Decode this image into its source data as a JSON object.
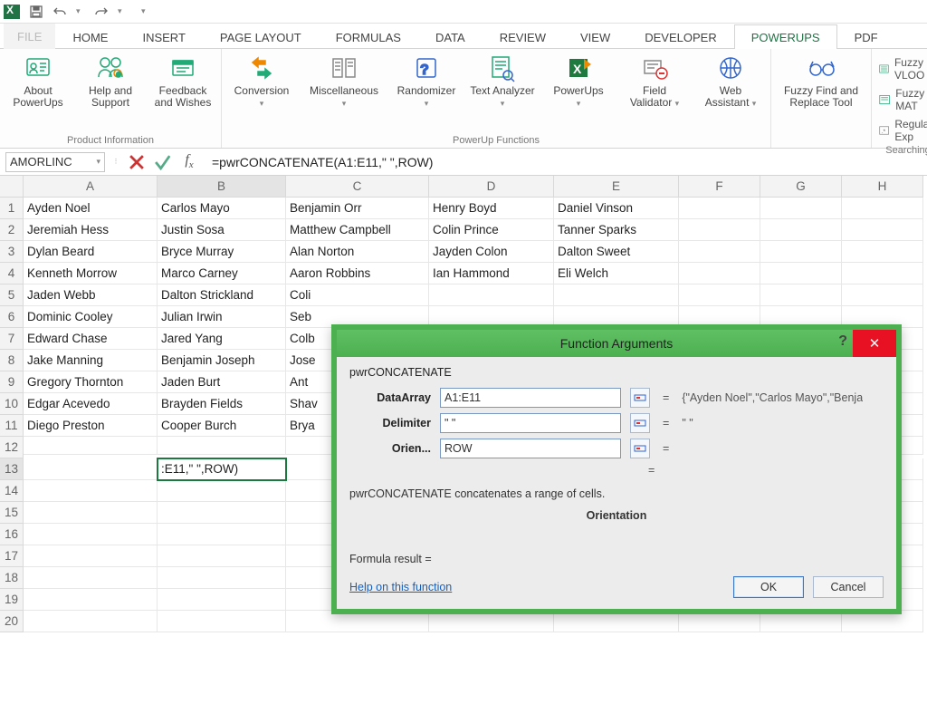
{
  "qat": {
    "save": "Save",
    "undo": "Undo",
    "redo": "Redo"
  },
  "tabs": {
    "file": "FILE",
    "home": "HOME",
    "insert": "INSERT",
    "page_layout": "PAGE LAYOUT",
    "formulas": "FORMULAS",
    "data": "DATA",
    "review": "REVIEW",
    "view": "VIEW",
    "developer": "DEVELOPER",
    "powerups": "POWERUPS",
    "pdf": "PDF"
  },
  "ribbon": {
    "group1": {
      "about": "About PowerUps",
      "help": "Help and Support",
      "feedback": "Feedback and Wishes",
      "label": "Product Information"
    },
    "group2": {
      "conversion": "Conversion",
      "misc": "Miscellaneous",
      "randomizer": "Randomizer",
      "text": "Text Analyzer",
      "powerups": "PowerUps",
      "field": "Field Validator",
      "web": "Web Assistant",
      "label": "PowerUp Functions"
    },
    "group3": {
      "fuzzy": "Fuzzy Find and Replace Tool"
    },
    "group4": {
      "vlook": "Fuzzy VLOO",
      "match": "Fuzzy MAT",
      "regex": "Regular Exp",
      "label": "Searching"
    }
  },
  "fml": {
    "name": "AMORLINC",
    "formula": "=pwrCONCATENATE(A1:E11,\" \",ROW)"
  },
  "columns": [
    "A",
    "B",
    "C",
    "D",
    "E",
    "F",
    "G",
    "H"
  ],
  "rows_visible": [
    "1",
    "2",
    "3",
    "4",
    "5",
    "6",
    "7",
    "8",
    "9",
    "10",
    "11",
    "12",
    "13",
    "14",
    "15",
    "16",
    "17",
    "18",
    "19",
    "20"
  ],
  "active_cell_display": ":E11,\" \",ROW)",
  "data": [
    [
      "Ayden Noel",
      "Carlos Mayo",
      "Benjamin Orr",
      "Henry Boyd",
      "Daniel Vinson"
    ],
    [
      "Jeremiah Hess",
      "Justin Sosa",
      "Matthew Campbell",
      "Colin Prince",
      "Tanner Sparks"
    ],
    [
      "Dylan Beard",
      "Bryce Murray",
      "Alan Norton",
      "Jayden Colon",
      "Dalton Sweet"
    ],
    [
      "Kenneth Morrow",
      "Marco Carney",
      "Aaron Robbins",
      "Ian Hammond",
      "Eli Welch"
    ],
    [
      "Jaden Webb",
      "Dalton Strickland",
      "Coli",
      "",
      " "
    ],
    [
      "Dominic Cooley",
      "Julian Irwin",
      "Seb",
      "",
      " "
    ],
    [
      "Edward Chase",
      "Jared Yang",
      "Colb",
      "",
      " "
    ],
    [
      "Jake Manning",
      "Benjamin Joseph",
      "Jose",
      "",
      " "
    ],
    [
      "Gregory Thornton",
      "Jaden Burt",
      "Ant",
      "",
      " "
    ],
    [
      "Edgar Acevedo",
      "Brayden Fields",
      "Shav",
      "",
      " "
    ],
    [
      "Diego Preston",
      "Cooper Burch",
      "Brya",
      "",
      " "
    ]
  ],
  "dialog": {
    "title": "Function Arguments",
    "fn": "pwrCONCATENATE",
    "args": {
      "a1": {
        "label": "DataArray",
        "value": "A1:E11",
        "result": "{\"Ayden Noel\",\"Carlos Mayo\",\"Benja"
      },
      "a2": {
        "label": "Delimiter",
        "value": "\" \"",
        "result": "\" \""
      },
      "a3": {
        "label": "Orien...",
        "value": "ROW",
        "result": ""
      }
    },
    "desc": "pwrCONCATENATE concatenates a range of cells.",
    "sub": "Orientation",
    "result_label": "Formula result =",
    "help": "Help on this function",
    "ok": "OK",
    "cancel": "Cancel"
  }
}
